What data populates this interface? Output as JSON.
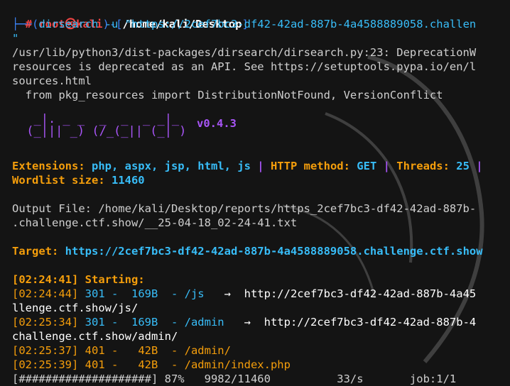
{
  "prompt": {
    "corner": "┌──(",
    "user": "root㉿kali",
    "sep": ")-[",
    "path": "/home/kali/Desktop",
    "close": "]",
    "line2_prefix": "└─",
    "hash": "#",
    "command": " dirsearch -u \"https://2cef7bc3-df42-42ad-887b-4a4588889058.challen",
    "wrap_quote": "\""
  },
  "warning": {
    "l1": "/usr/lib/python3/dist-packages/dirsearch/dirsearch.py:23: DeprecationW",
    "l2": "resources is deprecated as an API. See https://setuptools.pypa.io/en/l",
    "l3": "sources.html",
    "l4": "  from pkg_resources import DistributionNotFound, VersionConflict"
  },
  "logo": {
    "art": "  _|. _ _  _  _  _ _|_\n (_||| _) (/_(_|| (_| )",
    "version": "v0.4.3"
  },
  "config": {
    "ext_label": "Extensions: ",
    "ext_value": "php, aspx, jsp, html, js",
    "pipe1": " | ",
    "method_label": "HTTP method: ",
    "method_value": "GET",
    "pipe2": " | ",
    "threads_label": "Threads: ",
    "threads_value": "25",
    "pipe3": " |",
    "wordlist_label": "Wordlist size: ",
    "wordlist_value": "11460"
  },
  "output": {
    "l1": "Output File: /home/kali/Desktop/reports/https_2cef7bc3-df42-42ad-887b-",
    "l2": ".challenge.ctf.show/__25-04-18_02-24-41.txt"
  },
  "target": {
    "label": "Target: ",
    "url": "https://2cef7bc3-df42-42ad-887b-4a4588889058.challenge.ctf.show"
  },
  "results": {
    "starting_time": "[02:24:41]",
    "starting_label": " Starting:",
    "r1_time": "[02:24:44]",
    "r1_body": " 301 -  169B  - /js  ",
    "r1_arrow": " →  http://2cef7bc3-df42-42ad-887b-4a45",
    "r1_cont": "llenge.ctf.show/js/",
    "r2_time": "[02:25:34]",
    "r2_body": " 301 -  169B  - /admin  ",
    "r2_arrow": " →  http://2cef7bc3-df42-42ad-887b-4",
    "r2_cont": "challenge.ctf.show/admin/",
    "r3_time": "[02:25:37]",
    "r3_body": " 401 -   42B  - /admin/",
    "r4_time": "[02:25:39]",
    "r4_body": " 401 -   42B  - /admin/index.php",
    "progress": "[####################] 87%   9982/11460          33/s       job:1/1"
  },
  "colors": {
    "background": "#141414",
    "prompt_blue": "#3b82f6",
    "root_red": "#ef4444",
    "accent_orange": "#f59e0b",
    "accent_cyan": "#38bdf8",
    "logo_purple": "#a855f7"
  }
}
